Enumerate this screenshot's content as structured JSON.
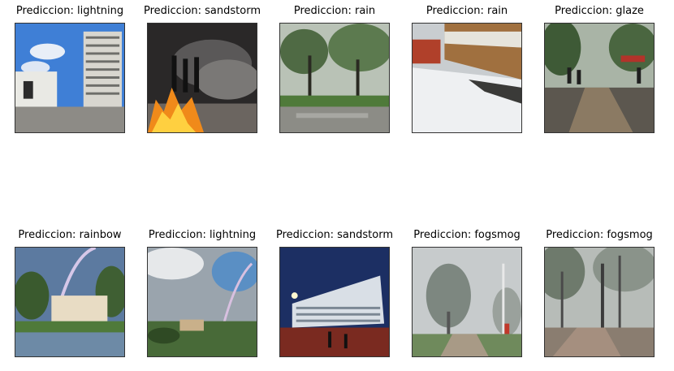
{
  "grid": {
    "rows": [
      {
        "cells": [
          {
            "title": "Prediccion: lightning",
            "image": "urban-building-blue-sky-photo"
          },
          {
            "title": "Prediccion: sandstorm",
            "image": "fire-smoke-protest-photo"
          },
          {
            "title": "Prediccion: rain",
            "image": "rainy-park-trees-photo"
          },
          {
            "title": "Prediccion: rain",
            "image": "hail-covered-campus-photo"
          },
          {
            "title": "Prediccion: glaze",
            "image": "wet-street-people-photo"
          }
        ]
      },
      {
        "cells": [
          {
            "title": "Prediccion: rainbow",
            "image": "rainbow-over-campus-photo"
          },
          {
            "title": "Prediccion: lightning",
            "image": "rainbow-cloudy-landscape-photo"
          },
          {
            "title": "Prediccion: sandstorm",
            "image": "night-lit-building-photo"
          },
          {
            "title": "Prediccion: fogsmog",
            "image": "foggy-trees-photo"
          },
          {
            "title": "Prediccion: fogsmog",
            "image": "foggy-path-trees-photo"
          }
        ]
      }
    ]
  }
}
